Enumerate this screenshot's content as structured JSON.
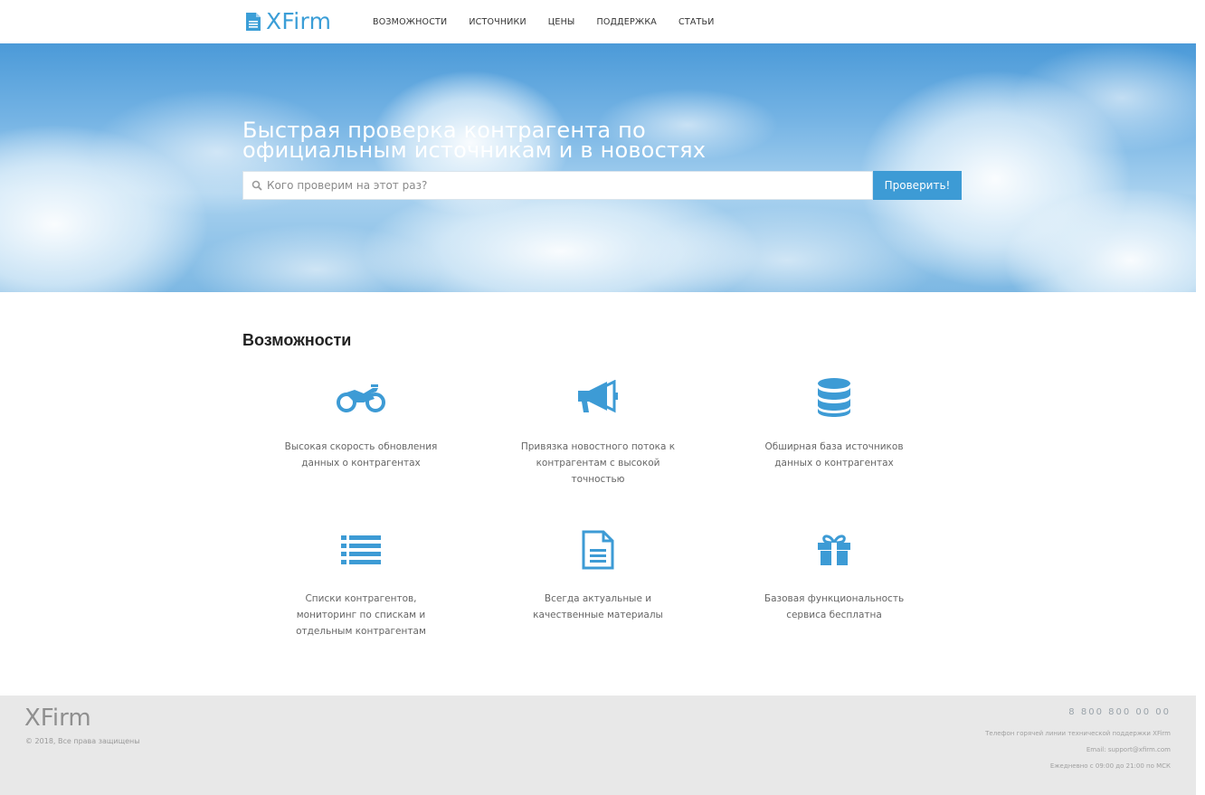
{
  "header": {
    "logo_text": "XFirm",
    "nav": [
      "ВОЗМОЖНОСТИ",
      "ИСТОЧНИКИ",
      "ЦЕНЫ",
      "ПОДДЕРЖКА",
      "СТАТЬИ"
    ]
  },
  "hero": {
    "title": "Быстрая проверка контрагента по официальным источникам и в новостях",
    "search_placeholder": "Кого проверим на этот раз?",
    "button_label": "Проверить!"
  },
  "features": {
    "title": "Возможности",
    "items": [
      {
        "icon": "motorcycle-icon",
        "text": "Высокая скорость обновления данных о контрагентах"
      },
      {
        "icon": "bullhorn-icon",
        "text": "Привязка новостного потока к контрагентам с высокой точностью"
      },
      {
        "icon": "database-icon",
        "text": "Обширная база источников данных о контрагентах"
      },
      {
        "icon": "list-icon",
        "text": "Списки контрагентов, мониторинг по спискам и отдельным контрагентам"
      },
      {
        "icon": "document-icon",
        "text": "Всегда актуальные и качественные материалы"
      },
      {
        "icon": "gift-icon",
        "text": "Базовая функциональность сервиса бесплатна"
      }
    ]
  },
  "footer": {
    "logo_text": "XFirm",
    "copyright": "© 2018, Все права защищены",
    "phone": "8 800 800 00 00",
    "hotline": "Телефон горячей линии технической поддержки XFirm",
    "email": "Email: support@xfirm.com",
    "hours": "Ежедневно с 09:00 до 21:00 по МСК"
  },
  "colors": {
    "accent": "#3d9bd5",
    "footer_bg": "#e8e8e8",
    "sky": "#74b3e4"
  }
}
